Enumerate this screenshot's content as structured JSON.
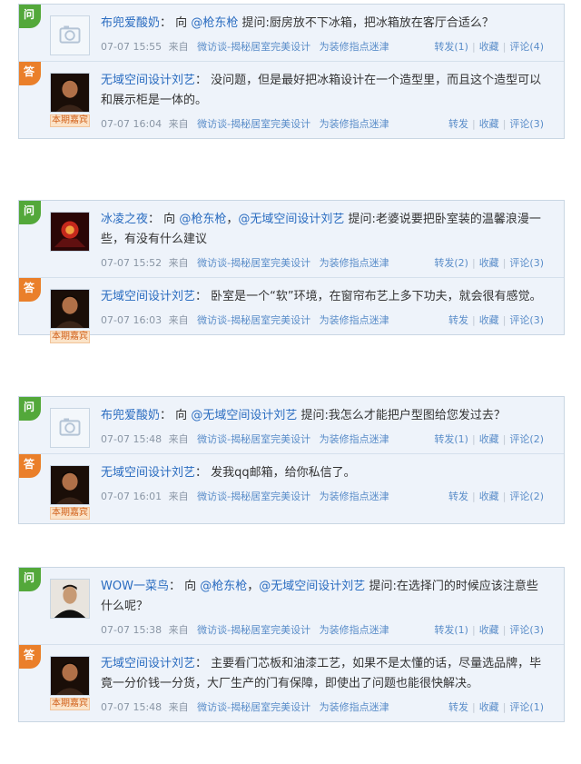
{
  "labels": {
    "question_tag": "问",
    "answer_tag": "答",
    "guest_badge": "本期嘉宾",
    "via": "来自",
    "source1": "微访谈-揭秘居室完美设计",
    "source2": "为装修指点迷津",
    "forward": "转发",
    "fav": "收藏",
    "comment": "评论",
    "to": "向",
    "ask": "提问:",
    "comma": "，"
  },
  "threads": [
    {
      "q": {
        "user": "布兜爱酸奶",
        "mentions": [
          "@枪东枪"
        ],
        "text": "厨房放不下冰箱，把冰箱放在客厅合适么？",
        "time": "07-07 15:55",
        "forward": "(1)",
        "comment": "(4)"
      },
      "a": {
        "user": "无域空间设计刘艺",
        "text": "没问题，但是最好把冰箱设计在一个造型里，而且这个造型可以和展示柜是一体的。",
        "time": "07-07 16:04",
        "comment": "(3)"
      }
    },
    {
      "q": {
        "user": "冰凌之夜",
        "mentions": [
          "@枪东枪",
          "@无域空间设计刘艺"
        ],
        "text": "老婆说要把卧室装的温馨浪漫一些，有没有什么建议",
        "time": "07-07 15:52",
        "forward": "(2)",
        "comment": "(3)"
      },
      "a": {
        "user": "无域空间设计刘艺",
        "text": "卧室是一个“软”环境，在窗帘布艺上多下功夫，就会很有感觉。",
        "time": "07-07 16:03",
        "comment": "(3)"
      }
    },
    {
      "q": {
        "user": "布兜爱酸奶",
        "mentions": [
          "@无域空间设计刘艺"
        ],
        "text": "我怎么才能把户型图给您发过去？",
        "time": "07-07 15:48",
        "forward": "(1)",
        "comment": "(2)"
      },
      "a": {
        "user": "无域空间设计刘艺",
        "text": "发我qq邮箱，给你私信了。",
        "time": "07-07 16:01",
        "comment": "(2)"
      }
    },
    {
      "q": {
        "user": "WOW一菜鸟",
        "mentions": [
          "@枪东枪",
          "@无域空间设计刘艺"
        ],
        "text": "在选择门的时候应该注意些什么呢？",
        "time": "07-07 15:38",
        "forward": "(1)",
        "comment": "(3)"
      },
      "a": {
        "user": "无域空间设计刘艺",
        "text": "主要看门芯板和油漆工艺，如果不是太懂的话，尽量选品牌，毕竟一分价钱一分货，大厂生产的门有保障，即使出了问题也能很快解决。",
        "time": "07-07 15:48",
        "comment": "(1)"
      }
    }
  ]
}
